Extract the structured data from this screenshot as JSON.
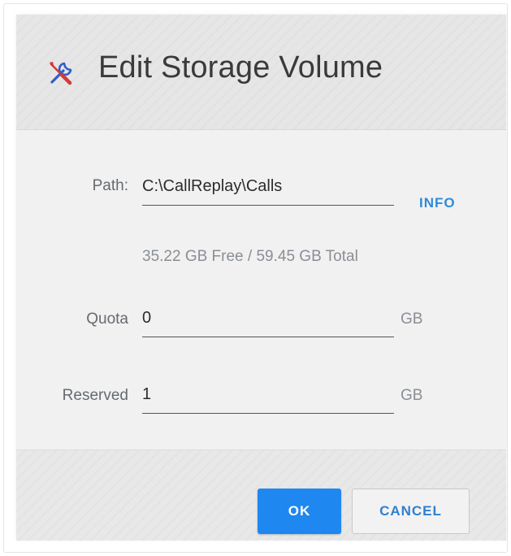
{
  "dialog": {
    "title": "Edit Storage Volume",
    "title_icon": "tools-icon",
    "colors": {
      "accent": "#1e88f0",
      "link": "#2f8ad8",
      "icon_blue": "#2f5fc8",
      "icon_red": "#d33a3a"
    }
  },
  "form": {
    "path": {
      "label": "Path:",
      "value": "C:\\CallReplay\\Calls"
    },
    "info_button": "INFO",
    "free_text": "35.22 GB Free / 59.45 GB Total",
    "quota": {
      "label": "Quota",
      "value": "0",
      "unit": "GB"
    },
    "reserved": {
      "label": "Reserved",
      "value": "1",
      "unit": "GB"
    }
  },
  "footer": {
    "ok_label": "OK",
    "cancel_label": "CANCEL"
  }
}
